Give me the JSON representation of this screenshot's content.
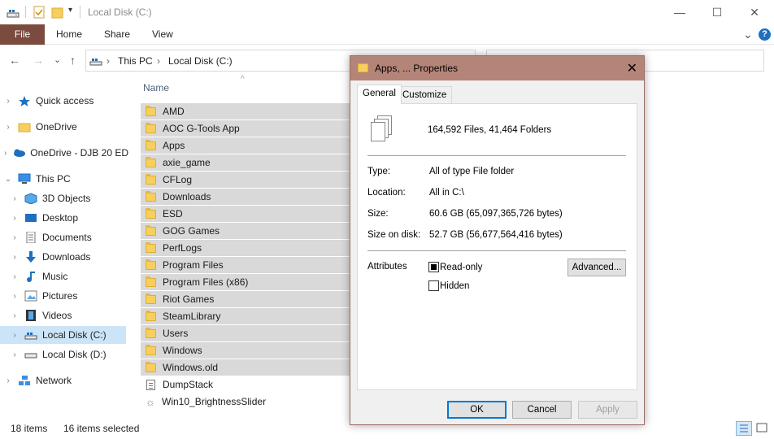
{
  "window": {
    "title": "Local Disk (C:)",
    "controls": {
      "minimize": "—",
      "maximize": "☐",
      "close": "✕"
    }
  },
  "ribbon": {
    "tabs": [
      "File",
      "Home",
      "Share",
      "View"
    ],
    "expand": "⌄",
    "help": "?"
  },
  "address": {
    "back": "←",
    "forward": "→",
    "recent": "⌄",
    "up": "↑",
    "crumbs": [
      "This PC",
      "Local Disk (C:)"
    ],
    "sep": "›",
    "dropdown": "⌄"
  },
  "nav": {
    "items": [
      {
        "label": "Quick access",
        "icon": "star-icon"
      },
      {
        "label": "OneDrive",
        "icon": "cloud-icon"
      },
      {
        "label": "OneDrive - DJB 20 ED",
        "icon": "cloud-icon"
      },
      {
        "label": "This PC",
        "icon": "pc-icon"
      },
      {
        "label": "3D Objects",
        "icon": "cube-icon"
      },
      {
        "label": "Desktop",
        "icon": "desktop-icon"
      },
      {
        "label": "Documents",
        "icon": "documents-icon"
      },
      {
        "label": "Downloads",
        "icon": "download-icon"
      },
      {
        "label": "Music",
        "icon": "music-icon"
      },
      {
        "label": "Pictures",
        "icon": "pictures-icon"
      },
      {
        "label": "Videos",
        "icon": "videos-icon"
      },
      {
        "label": "Local Disk (C:)",
        "icon": "drive-icon"
      },
      {
        "label": "Local Disk (D:)",
        "icon": "drive-icon"
      },
      {
        "label": "Network",
        "icon": "network-icon"
      }
    ]
  },
  "list": {
    "column_name": "Name",
    "sort_glyph": "^",
    "rows": [
      {
        "name": "AMD",
        "type": "folder",
        "selected": true
      },
      {
        "name": "AOC G-Tools App",
        "type": "folder",
        "selected": true
      },
      {
        "name": "Apps",
        "type": "folder",
        "selected": true
      },
      {
        "name": "axie_game",
        "type": "folder",
        "selected": true
      },
      {
        "name": "CFLog",
        "type": "folder",
        "selected": true
      },
      {
        "name": "Downloads",
        "type": "folder",
        "selected": true
      },
      {
        "name": "ESD",
        "type": "folder",
        "selected": true
      },
      {
        "name": "GOG Games",
        "type": "folder",
        "selected": true
      },
      {
        "name": "PerfLogs",
        "type": "folder",
        "selected": true
      },
      {
        "name": "Program Files",
        "type": "folder",
        "selected": true
      },
      {
        "name": "Program Files (x86)",
        "type": "folder",
        "selected": true
      },
      {
        "name": "Riot Games",
        "type": "folder",
        "selected": true
      },
      {
        "name": "SteamLibrary",
        "type": "folder",
        "selected": true
      },
      {
        "name": "Users",
        "type": "folder",
        "selected": true
      },
      {
        "name": "Windows",
        "type": "folder",
        "selected": true
      },
      {
        "name": "Windows.old",
        "type": "folder",
        "selected": true
      },
      {
        "name": "DumpStack",
        "type": "file",
        "selected": false
      },
      {
        "name": "Win10_BrightnessSlider",
        "type": "app",
        "selected": false
      }
    ]
  },
  "status": {
    "items": "18 items",
    "selected": "16 items selected"
  },
  "dialog": {
    "title": "Apps, ... Properties",
    "close": "✕",
    "tabs": [
      "General",
      "Customize"
    ],
    "summary": "164,592 Files, 41,464 Folders",
    "fields": [
      {
        "label": "Type:",
        "value": "All of type File folder"
      },
      {
        "label": "Location:",
        "value": "All in C:\\"
      },
      {
        "label": "Size:",
        "value": "60.6 GB (65,097,365,726 bytes)"
      },
      {
        "label": "Size on disk:",
        "value": "52.7 GB (56,677,564,416 bytes)"
      }
    ],
    "attributes_label": "Attributes",
    "readonly_label": "Read-only",
    "hidden_label": "Hidden",
    "advanced_label": "Advanced...",
    "ok_label": "OK",
    "cancel_label": "Cancel",
    "apply_label": "Apply"
  },
  "colors": {
    "file_tab": "#7a4b3e",
    "dialog_caption": "#b58478",
    "selection": "#d9d9d9",
    "nav_selection": "#cce4f7",
    "folder": "#f7cf5e",
    "default_button_border": "#0078d7"
  }
}
